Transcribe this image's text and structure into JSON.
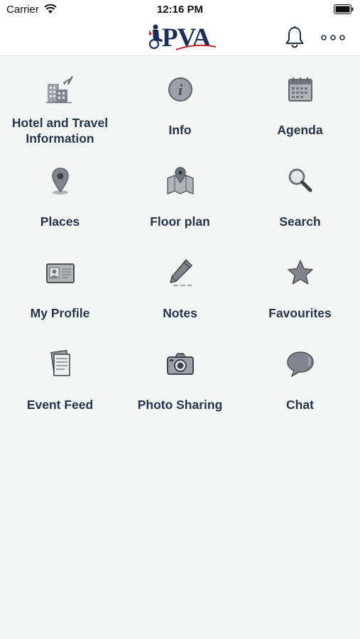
{
  "status": {
    "carrier": "Carrier",
    "time": "12:16 PM"
  },
  "header": {
    "logo_text": "PVA"
  },
  "tiles": [
    {
      "label": "Hotel and Travel Information",
      "icon": "hotel-travel-icon"
    },
    {
      "label": "Info",
      "icon": "info-icon"
    },
    {
      "label": "Agenda",
      "icon": "calendar-icon"
    },
    {
      "label": "Places",
      "icon": "map-pin-icon"
    },
    {
      "label": "Floor plan",
      "icon": "floor-plan-map-icon"
    },
    {
      "label": "Search",
      "icon": "magnifier-icon"
    },
    {
      "label": "My Profile",
      "icon": "id-card-icon"
    },
    {
      "label": "Notes",
      "icon": "pen-icon"
    },
    {
      "label": "Favourites",
      "icon": "star-icon"
    },
    {
      "label": "Event Feed",
      "icon": "document-stack-icon"
    },
    {
      "label": "Photo Sharing",
      "icon": "camera-icon"
    },
    {
      "label": "Chat",
      "icon": "speech-bubble-icon"
    }
  ],
  "colors": {
    "background": "#f4f6f6",
    "icon_gray": "#8a9198",
    "label": "#25344a",
    "brand_navy": "#1c2b5a",
    "brand_red": "#c0262e"
  }
}
